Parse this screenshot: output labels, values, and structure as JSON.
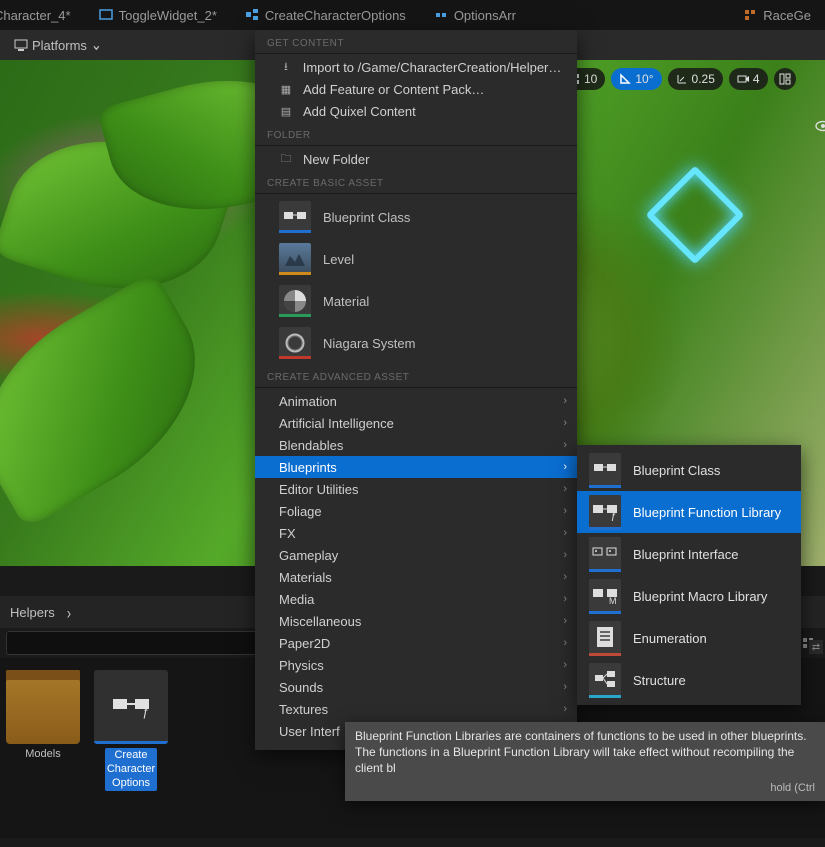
{
  "tabs": [
    {
      "label": "Character_4*"
    },
    {
      "label": "ToggleWidget_2*"
    },
    {
      "label": "CreateCharacterOptions"
    },
    {
      "label": "OptionsArr"
    },
    {
      "label": "RaceGe"
    }
  ],
  "toolbar": {
    "platforms_label": "Platforms"
  },
  "viewport_hud": {
    "snap1": "10",
    "snap_angle": "10°",
    "scale": "0.25",
    "camera": "4"
  },
  "breadcrumb": {
    "folder": "Helpers"
  },
  "assets": {
    "models": "Models",
    "create_char": "Create\nCharacter\nOptions"
  },
  "context_menu": {
    "sections": {
      "get_content": "GET CONTENT",
      "folder": "FOLDER",
      "basic": "CREATE BASIC ASSET",
      "advanced": "CREATE ADVANCED ASSET"
    },
    "get_content_items": {
      "import": "Import to /Game/CharacterCreation/Helpers…",
      "add_feature": "Add Feature or Content Pack…",
      "quixel": "Add Quixel Content"
    },
    "folder_items": {
      "new_folder": "New Folder"
    },
    "basic_items": {
      "blueprint_class": "Blueprint Class",
      "level": "Level",
      "material": "Material",
      "niagara": "Niagara System"
    },
    "advanced_items": [
      "Animation",
      "Artificial Intelligence",
      "Blendables",
      "Blueprints",
      "Editor Utilities",
      "Foliage",
      "FX",
      "Gameplay",
      "Materials",
      "Media",
      "Miscellaneous",
      "Paper2D",
      "Physics",
      "Sounds",
      "Textures",
      "User Interf"
    ],
    "advanced_highlight_index": 3
  },
  "submenu": [
    {
      "label": "Blueprint Class",
      "bar": "#1f6fd0"
    },
    {
      "label": "Blueprint Function Library",
      "bar": "#1f6fd0"
    },
    {
      "label": "Blueprint Interface",
      "bar": "#1f6fd0"
    },
    {
      "label": "Blueprint Macro Library",
      "bar": "#1f6fd0"
    },
    {
      "label": "Enumeration",
      "bar": "#c04a3a"
    },
    {
      "label": "Structure",
      "bar": "#2aa6c8"
    }
  ],
  "submenu_highlight_index": 1,
  "tooltip": {
    "text": "Blueprint Function Libraries are containers of functions to be used in other blueprints. The functions in a Blueprint Function Library will take effect without recompiling the client bl",
    "hint": "hold (Ctrl"
  }
}
